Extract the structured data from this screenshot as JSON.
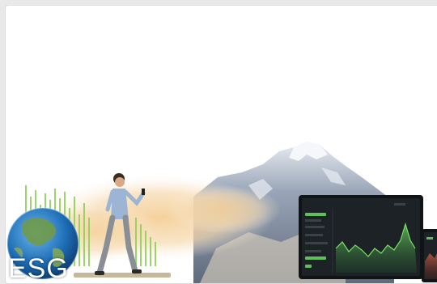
{
  "card": {
    "esg_label": "ESG"
  },
  "colors": {
    "background": "#e9e9e9",
    "card": "#ffffff",
    "mist": "#f2c98c",
    "mountain": "#7d8aa0",
    "snow": "#eef1f5",
    "bars_green": "#8fd15a",
    "screen_dark": "#1c2226",
    "chart_green": "#5fbf5a",
    "chart_red": "#c0564a"
  },
  "icons": [
    "globe-icon"
  ]
}
